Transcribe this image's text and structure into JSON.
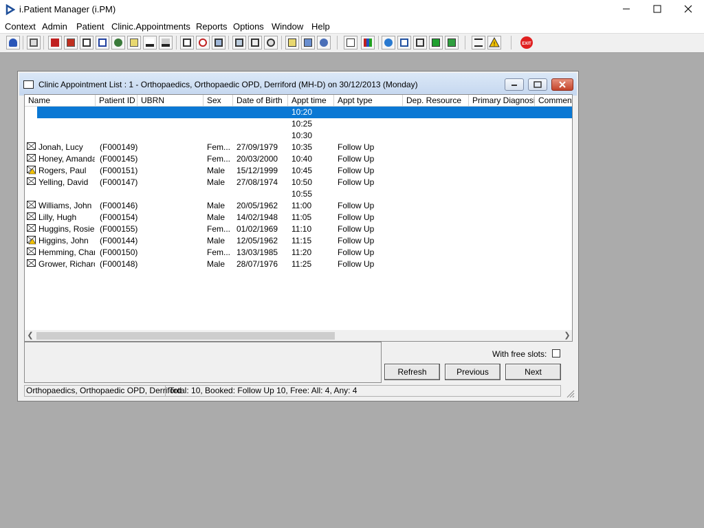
{
  "app": {
    "title": "i.Patient Manager (i.PM)"
  },
  "menu": [
    "Context",
    "Admin",
    "Patient",
    "Clinic.Appointments",
    "Reports",
    "Options",
    "Window",
    "Help"
  ],
  "window": {
    "title": "Clinic Appointment List : 1 - Orthopaedics, Orthopaedic OPD, Derriford (MH-D) on 30/12/2013 (Monday)"
  },
  "table": {
    "columns": [
      "Name",
      "Patient ID",
      "UBRN",
      "Sex",
      "Date of Birth",
      "Appt time",
      "Appt type",
      "Dep. Resource",
      "Primary Diagnosis",
      "Comments"
    ],
    "rows": [
      {
        "name": "",
        "pid": "",
        "ubrn": "",
        "sex": "",
        "dob": "",
        "time": "10:20",
        "type": "",
        "selected": true,
        "icon": ""
      },
      {
        "name": "",
        "pid": "",
        "ubrn": "",
        "sex": "",
        "dob": "",
        "time": "10:25",
        "type": "",
        "icon": ""
      },
      {
        "name": "",
        "pid": "",
        "ubrn": "",
        "sex": "",
        "dob": "",
        "time": "10:30",
        "type": "",
        "icon": ""
      },
      {
        "name": "Jonah, Lucy",
        "pid": "(F000149)",
        "ubrn": "",
        "sex": "Fem...",
        "dob": "27/09/1979",
        "time": "10:35",
        "type": "Follow Up",
        "icon": "appointment-icon"
      },
      {
        "name": "Honey, Amanda",
        "pid": "(F000145)",
        "ubrn": "",
        "sex": "Fem...",
        "dob": "20/03/2000",
        "time": "10:40",
        "type": "Follow Up",
        "icon": "appointment-icon"
      },
      {
        "name": "Rogers, Paul",
        "pid": "(F000151)",
        "ubrn": "",
        "sex": "Male",
        "dob": "15/12/1999",
        "time": "10:45",
        "type": "Follow Up",
        "icon": "appointment-warning-icon"
      },
      {
        "name": "Yelling, David",
        "pid": "(F000147)",
        "ubrn": "",
        "sex": "Male",
        "dob": "27/08/1974",
        "time": "10:50",
        "type": "Follow Up",
        "icon": "appointment-icon"
      },
      {
        "name": "",
        "pid": "",
        "ubrn": "",
        "sex": "",
        "dob": "",
        "time": "10:55",
        "type": "",
        "icon": ""
      },
      {
        "name": "Williams, John",
        "pid": "(F000146)",
        "ubrn": "",
        "sex": "Male",
        "dob": "20/05/1962",
        "time": "11:00",
        "type": "Follow Up",
        "icon": "appointment-icon"
      },
      {
        "name": "Lilly, Hugh",
        "pid": "(F000154)",
        "ubrn": "",
        "sex": "Male",
        "dob": "14/02/1948",
        "time": "11:05",
        "type": "Follow Up",
        "icon": "appointment-icon"
      },
      {
        "name": "Huggins, Rosie",
        "pid": "(F000155)",
        "ubrn": "",
        "sex": "Fem...",
        "dob": "01/02/1969",
        "time": "11:10",
        "type": "Follow Up",
        "icon": "appointment-icon"
      },
      {
        "name": "Higgins, John",
        "pid": "(F000144)",
        "ubrn": "",
        "sex": "Male",
        "dob": "12/05/1962",
        "time": "11:15",
        "type": "Follow Up",
        "icon": "appointment-warning-icon"
      },
      {
        "name": "Hemming, Char...",
        "pid": "(F000150)",
        "ubrn": "",
        "sex": "Fem...",
        "dob": "13/03/1985",
        "time": "11:20",
        "type": "Follow Up",
        "icon": "appointment-icon"
      },
      {
        "name": "Grower, Richard",
        "pid": "(F000148)",
        "ubrn": "",
        "sex": "Male",
        "dob": "28/07/1976",
        "time": "11:25",
        "type": "Follow Up",
        "icon": "appointment-icon"
      }
    ]
  },
  "free_slots": {
    "label": "With free slots:",
    "checked": false
  },
  "buttons": {
    "refresh": "Refresh",
    "previous": "Previous",
    "next": "Next"
  },
  "status": {
    "location": "Orthopaedics, Orthopaedic OPD, Derriford",
    "summary": "Total: 10, Booked: Follow Up 10, Free: All: 4, Any: 4"
  },
  "colors": {
    "selection": "#0a78d4",
    "desktop": "#ababab",
    "exit": "#e02020"
  },
  "toolbar_icons": [
    "user-icon",
    "print-icon",
    "book-icon",
    "edit-icon",
    "list-icon",
    "letter-icon",
    "doctor-icon",
    "notes-icon",
    "ambulance-icon",
    "transport-icon",
    "appointment-icon",
    "clock-icon",
    "screen-icon",
    "schedule-icon",
    "form-icon",
    "time-icon",
    "notepad-icon",
    "bed-icon",
    "nurse-icon",
    "document-icon",
    "chart-icon",
    "globe-icon",
    "envelope-icon",
    "transfer-icon",
    "refresh-green-icon",
    "refresh-arrows-icon",
    "swap-icon",
    "warning-icon",
    "exit-icon"
  ]
}
